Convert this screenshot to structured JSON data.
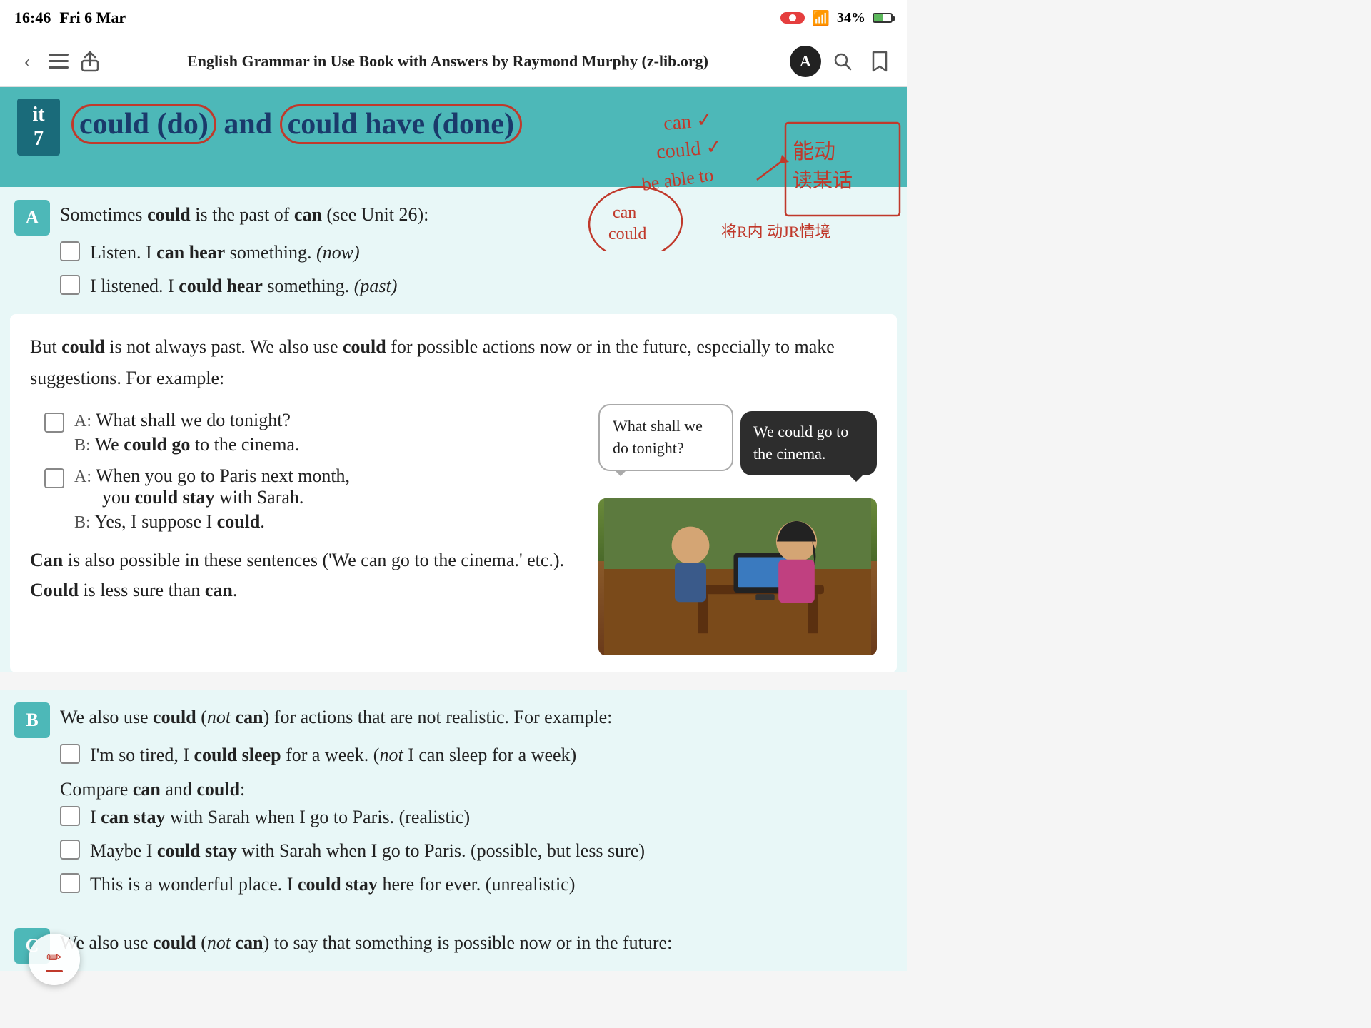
{
  "status": {
    "time": "16:46",
    "date": "Fri 6 Mar",
    "wifi": "34%",
    "wifi_icon": "📶"
  },
  "nav": {
    "title": "English Grammar in Use Book with Answers by Raymond Murphy (z-lib.org)",
    "back_label": "‹",
    "list_icon": "☰",
    "share_icon": "⬆",
    "search_icon": "🔍",
    "bookmark_icon": "🔖"
  },
  "unit": {
    "id_label": "it",
    "number": "7",
    "title_part1": "could (do)",
    "title_and": " and ",
    "title_part2": "could have (done)"
  },
  "section_a": {
    "badge": "A",
    "intro": "Sometimes",
    "intro_bold": "could",
    "intro_rest": " is the past of",
    "can_word": "can",
    "intro_rest2": "(see Unit 26):",
    "items": [
      {
        "label": "Listen.  I",
        "bold": "can hear",
        "rest": " something.  (now)"
      },
      {
        "label": "I listened.  I",
        "bold": "could hear",
        "rest": " something.  (past)"
      }
    ]
  },
  "card": {
    "intro": "But",
    "bold1": "could",
    "rest1": " is not always past.  We also use",
    "bold2": "could",
    "rest2": " for possible actions now or in the future, especially to make suggestions.  For example:",
    "dialogues": [
      {
        "a": "What shall we do tonight?",
        "b_pre": "We",
        "b_bold": "could go",
        "b_rest": " to the cinema."
      },
      {
        "a": "When you go to Paris next month, you",
        "a_bold": "could stay",
        "a_rest": " with Sarah.",
        "b_pre": "Yes, I suppose I",
        "b_bold": "could",
        "b_rest": "."
      }
    ],
    "footer1_bold": "Can",
    "footer1_rest": " is also possible in these sentences ('We can go to the cinema.' etc.).",
    "footer2_bold": "Could",
    "footer2_rest": " is less sure than",
    "footer2_bold2": "can",
    "footer2_end": ".",
    "speech_left": "What shall we do tonight?",
    "speech_right": "We could go to the cinema."
  },
  "section_b": {
    "badge": "B",
    "intro_pre": "We also use",
    "intro_bold": "could",
    "intro_paren": "(not can)",
    "intro_rest": " for actions that are not realistic.  For example:",
    "items": [
      {
        "text_pre": "I'm so tired, I",
        "text_bold": "could sleep",
        "text_rest": " for a week.  (",
        "text_italic": "not",
        "text_end": " I can sleep for a week)"
      }
    ],
    "compare": "Compare",
    "compare_bold1": "can",
    "compare_and": " and",
    "compare_bold2": "could",
    "compare_end": ":",
    "compare_items": [
      {
        "pre": "I",
        "bold": "can stay",
        "rest": " with Sarah when I go to Paris.  (realistic)"
      },
      {
        "pre": "Maybe I",
        "bold": "could stay",
        "rest": " with Sarah when I go to Paris.  (possible, but less sure)"
      },
      {
        "pre": "This is a wonderful place.  I",
        "bold": "could stay",
        "rest": " here for ever.  (unrealistic)"
      }
    ]
  },
  "section_c": {
    "badge": "C",
    "intro_pre": "We also use",
    "intro_bold": "could",
    "intro_paren": "(not can)",
    "intro_rest": " to say that something is possible now or in the future:"
  },
  "colors": {
    "teal": "#4db8b8",
    "dark_teal": "#1a6b7a",
    "blue_title": "#1a3a6b",
    "red_annotation": "#c0392b",
    "section_bg": "#e8f7f7"
  }
}
